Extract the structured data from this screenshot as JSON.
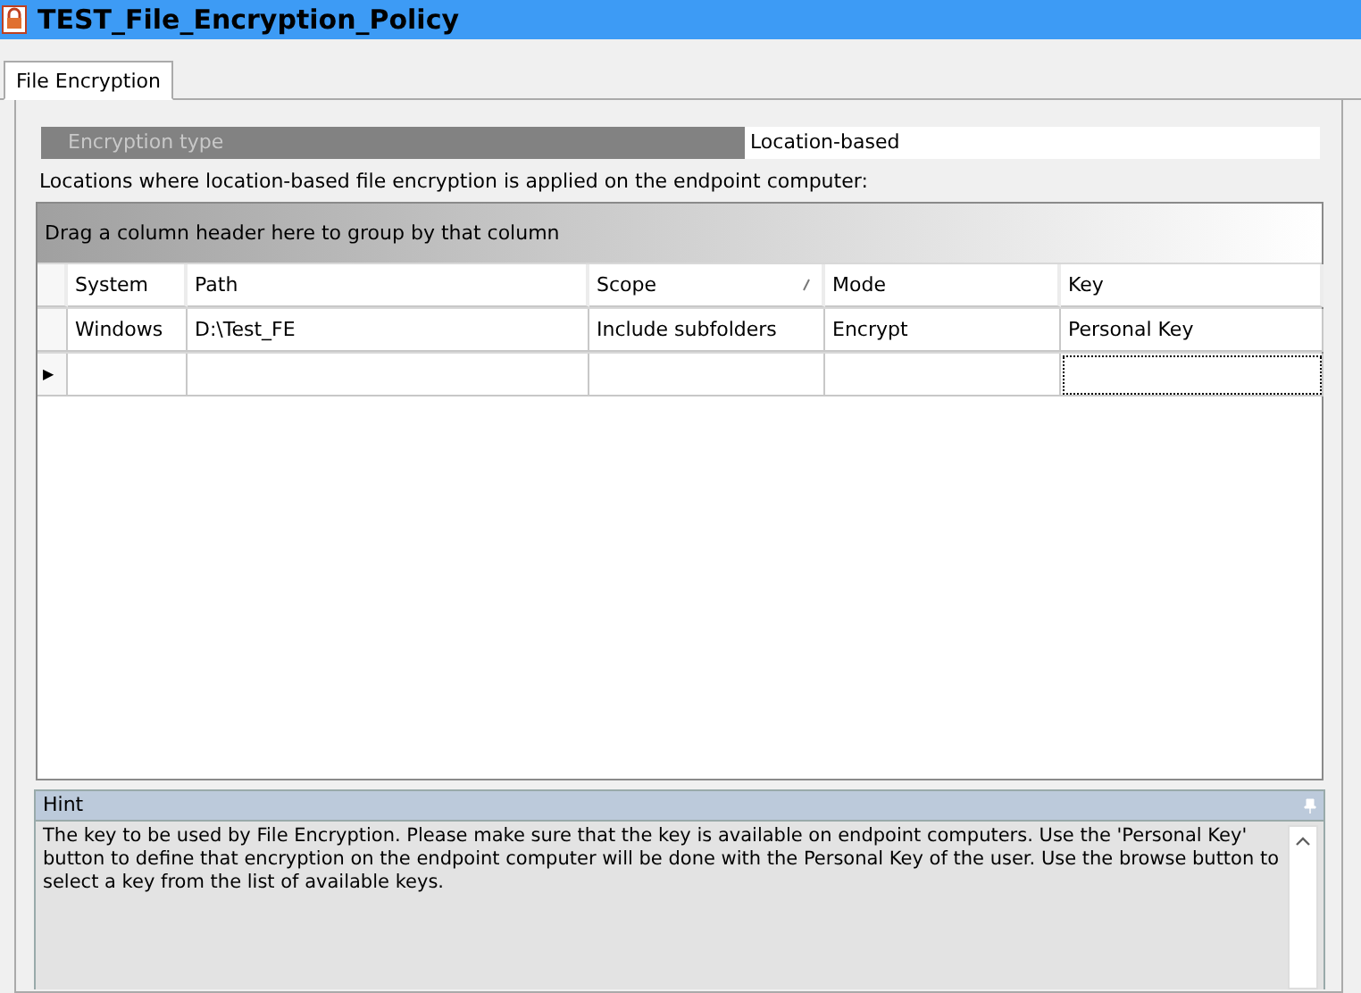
{
  "window": {
    "title": "TEST_File_Encryption_Policy"
  },
  "tabs": [
    {
      "label": "File Encryption",
      "selected": true
    }
  ],
  "encryption_type": {
    "label": "Encryption type",
    "value": "Location-based"
  },
  "description": "Locations where location-based file encryption is applied on the endpoint computer:",
  "grid": {
    "group_panel": "Drag a column header here to group by that column",
    "columns": [
      {
        "label": "System",
        "sorted": false
      },
      {
        "label": "Path",
        "sorted": false
      },
      {
        "label": "Scope",
        "sorted": true
      },
      {
        "label": "Mode",
        "sorted": false
      },
      {
        "label": "Key",
        "sorted": false
      }
    ],
    "rows": [
      {
        "cells": [
          "Windows",
          "D:\\Test_FE",
          "Include subfolders",
          "Encrypt",
          "Personal Key"
        ]
      }
    ],
    "new_row": {
      "indicator": "▶",
      "cells": [
        {
          "focused": false
        },
        {
          "focused": false
        },
        {
          "focused": false
        },
        {
          "focused": false
        },
        {
          "focused": true
        }
      ]
    }
  },
  "hint": {
    "title": "Hint",
    "text": "The key to be used by File Encryption. Please make sure that the key is available on endpoint computers. Use the 'Personal Key' button to define that encryption on the endpoint computer will be done with the Personal Key of the user. Use the browse button to select a key from the list of available keys."
  }
}
